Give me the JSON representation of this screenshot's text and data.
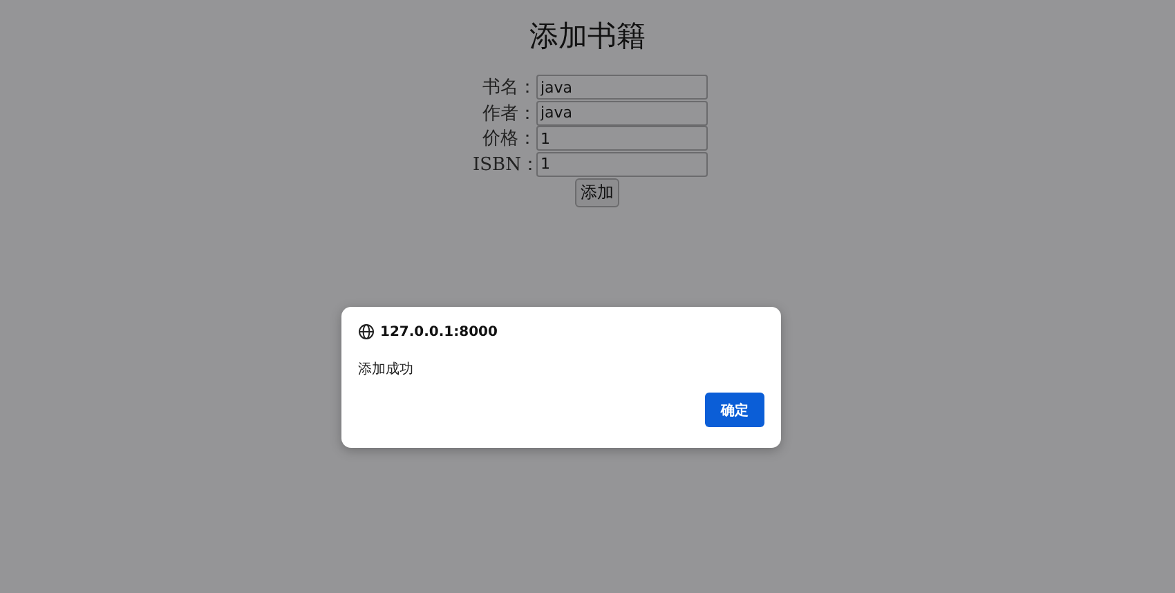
{
  "page": {
    "title": "添加书籍",
    "fields": [
      {
        "label": "书名：",
        "value": "java"
      },
      {
        "label": "作者：",
        "value": "java"
      },
      {
        "label": "价格：",
        "value": "1"
      },
      {
        "label": "ISBN：",
        "value": "1"
      }
    ],
    "submit_button": "添加"
  },
  "dialog": {
    "origin": "127.0.0.1:8000",
    "message": "添加成功",
    "ok_button": "确定"
  }
}
